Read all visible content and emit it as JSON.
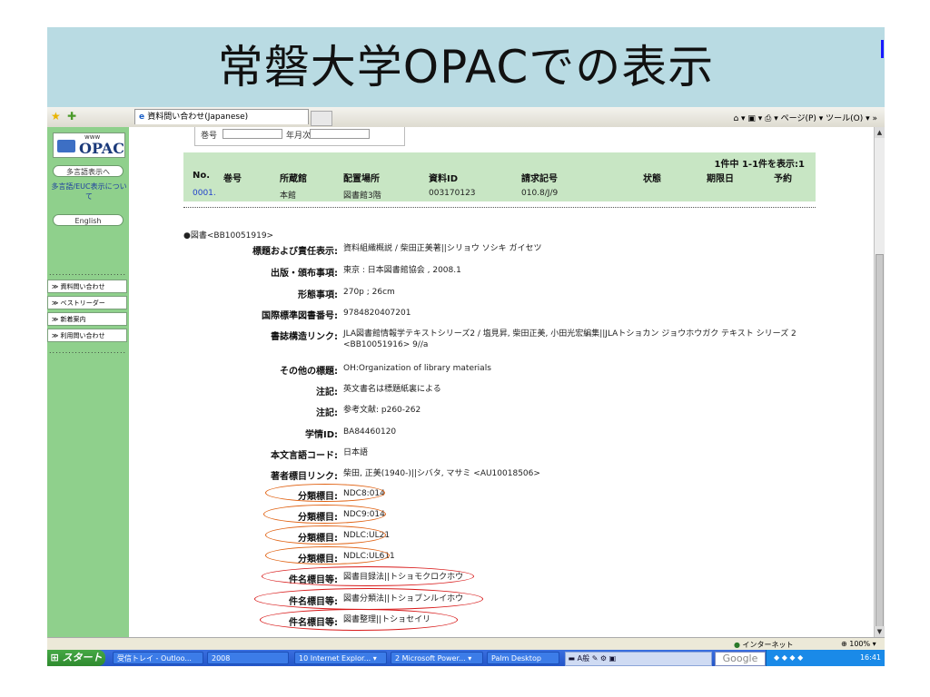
{
  "slide": {
    "title": "常磐大学OPACでの表示"
  },
  "browser": {
    "tab_title": "資料問い合わせ(Japanese)",
    "toolbar_right": "ページ(P) ▾ ツール(O) ▾ »"
  },
  "sidebar": {
    "logo_www": "www",
    "logo_text": "OPAC",
    "multilang_button": "多言語表示へ",
    "euc_link": "多言語/EUC表示について",
    "english_button": "English",
    "dots": "........................",
    "nav_items": [
      "≫ 資料問い合わせ",
      "≫ ベストリーダー",
      "≫ 新着案内",
      "≫ 利用問い合わせ"
    ]
  },
  "search": {
    "volume_label": "巻号",
    "date_label": "年月次"
  },
  "holdings": {
    "count_text": "1件中 1-1件を表示:1",
    "headers": [
      "No.",
      "巻号",
      "所蔵館",
      "配置場所",
      "資料ID",
      "請求記号",
      "状態",
      "期限日",
      "予約"
    ],
    "rows": [
      {
        "no": "0001.",
        "volume": "",
        "library": "本館",
        "location": "図書館3階",
        "id": "003170123",
        "call": "010.8/J/9",
        "status": "",
        "due": "",
        "reserve": ""
      }
    ]
  },
  "bib": {
    "bib_id": "●図書<BB10051919>",
    "fields": [
      {
        "label": "標題および責任表示:",
        "value": "資料組織概説 / 柴田正美著||シリョウ ソシキ ガイセツ",
        "link": false
      },
      {
        "label": "出版・頒布事項:",
        "value": "東京 : 日本図書館協会 , 2008.1",
        "link": false
      },
      {
        "label": "形態事項:",
        "value": "270p ; 26cm",
        "link": false
      },
      {
        "label": "国際標準図書番号:",
        "value": "9784820407201",
        "link": false
      },
      {
        "label": "書誌構造リンク:",
        "value": "JLA図書館情報学テキストシリーズ2 / 塩見昇, 柴田正美, 小田光宏編集||JLAトショカン ジョウホウガク テキスト シリーズ 2 <BB10051916> 9//a",
        "link": true
      },
      {
        "label": "その他の標題:",
        "value": "OH:Organization of library materials",
        "link": false
      },
      {
        "label": "注記:",
        "value": "英文書名は標題紙裏による",
        "link": false
      },
      {
        "label": "注記:",
        "value": "参考文献: p260-262",
        "link": false
      },
      {
        "label": "学情ID:",
        "value": "BA84460120",
        "link": false
      },
      {
        "label": "本文言語コード:",
        "value": "日本語",
        "link": false
      },
      {
        "label": "著者標目リンク:",
        "value": "柴田, 正美(1940-)||シバタ, マサミ <AU10018506>",
        "link": true
      },
      {
        "label": "分類標目:",
        "value": "NDC8:014",
        "link": true
      },
      {
        "label": "分類標目:",
        "value": "NDC9:014",
        "link": true
      },
      {
        "label": "分類標目:",
        "value": "NDLC:UL21",
        "link": true
      },
      {
        "label": "分類標目:",
        "value": "NDLC:UL611",
        "link": true
      },
      {
        "label": "件名標目等:",
        "value": "図書目録法||トショモクロクホウ",
        "link": true
      },
      {
        "label": "件名標目等:",
        "value": "図書分類法||トショブンルイホウ",
        "link": true
      },
      {
        "label": "件名標目等:",
        "value": "図書整理||トショセイリ",
        "link": true
      }
    ]
  },
  "status": {
    "zone": "インターネット",
    "zoom": "100%"
  },
  "taskbar": {
    "start": "スタート",
    "tasks": [
      "受信トレイ - Outloo...",
      "2008",
      "10 Internet Explor... ▾",
      "2 Microsoft Power... ▾",
      "Palm Desktop"
    ],
    "lang_bar": "A般",
    "search_box": "Google",
    "clock": "16:41"
  }
}
